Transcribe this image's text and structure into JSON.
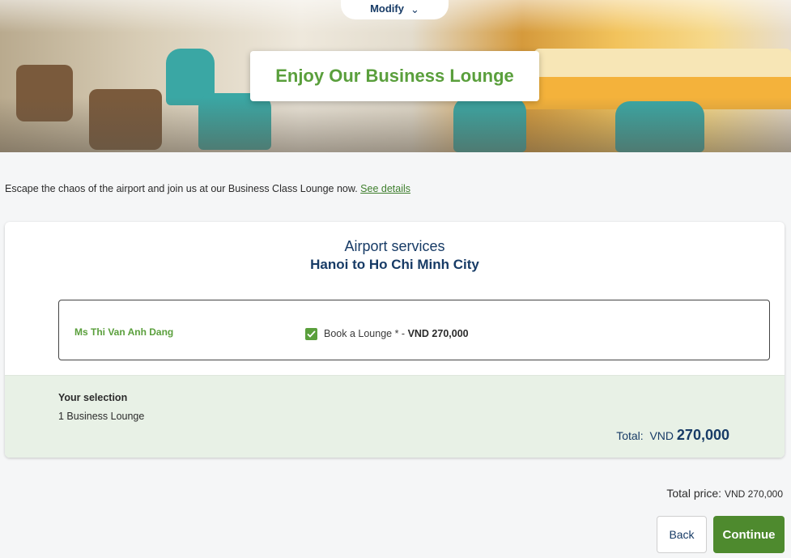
{
  "hero": {
    "modify_label": "Modify",
    "modify_chevron": "⌄",
    "title": "Enjoy Our Business Lounge"
  },
  "intro": {
    "text": "Escape the chaos of the airport and join us at our Business Class Lounge now.",
    "link": "See details"
  },
  "service": {
    "title": "Airport services",
    "route": "Hanoi to Ho Chi Minh City"
  },
  "passenger": {
    "name": "Ms Thi Van Anh Dang",
    "option_label": "Book a Lounge * -",
    "option_price": "VND 270,000",
    "checked": true
  },
  "selection": {
    "heading": "Your selection",
    "item": "1 Business Lounge",
    "total_label": "Total:",
    "total_currency": "VND",
    "total_amount": "270,000"
  },
  "footer": {
    "total_label": "Total price:",
    "total_value": "VND 270,000",
    "back_label": "Back",
    "continue_label": "Continue"
  },
  "colors": {
    "brand_green": "#5a9f3c",
    "button_green": "#4e8a2e",
    "navy": "#173b66",
    "selection_bg": "#e8f1e6"
  }
}
